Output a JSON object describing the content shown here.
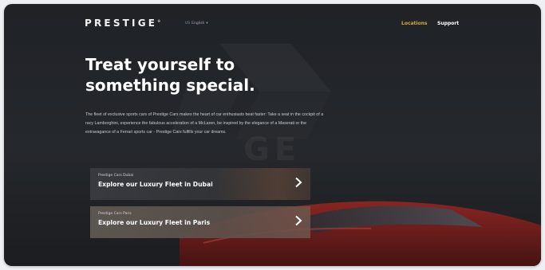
{
  "header": {
    "logo": "PRESTIGE",
    "logo_mark": "®",
    "language": {
      "flag": "US",
      "label": "English"
    },
    "nav": {
      "locations": "Locations",
      "support": "Support"
    }
  },
  "hero": {
    "headline_line1": "Treat yourself to",
    "headline_line2": "something special.",
    "intro": "The fleet of exclusive sports cars of Prestige Cars makes the heart of car enthusiasts beat faster: Take a seat in the cockpit of a racy Lamborghini, experience the fabulous acceleration of a McLaren, be inspired by the elegance of a Maserati or the extravagance of a Ferrari sports car - Prestige Cars fulfills your car dreams."
  },
  "cards": [
    {
      "subtitle": "Prestige Cars Dubai",
      "title": "Explore our Luxury Fleet in Dubai"
    },
    {
      "subtitle": "Prestige Cars Paris",
      "title": "Explore our Luxury Fleet in Paris"
    }
  ],
  "colors": {
    "accent": "#d9a93a",
    "background": "#222529",
    "car_red": "#7a1f1d"
  },
  "icons": {
    "language_chevron": "chevron-down-icon",
    "card_arrow": "chevron-right-icon"
  }
}
